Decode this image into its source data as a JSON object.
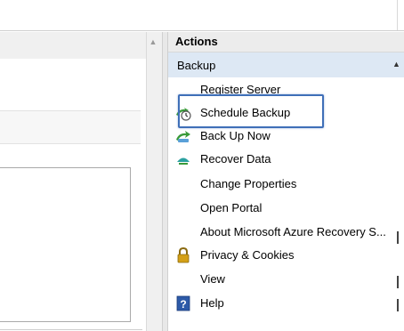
{
  "actions": {
    "title": "Actions",
    "section": "Backup",
    "items": [
      {
        "label": "Register Server",
        "icon": "none"
      },
      {
        "label": "Schedule Backup",
        "icon": "schedule-backup-icon"
      },
      {
        "label": "Back Up Now",
        "icon": "backup-now-icon"
      },
      {
        "label": "Recover Data",
        "icon": "recover-data-icon"
      },
      {
        "label": "Change Properties",
        "icon": "none"
      },
      {
        "label": "Open Portal",
        "icon": "none"
      },
      {
        "label": "About Microsoft Azure Recovery S...",
        "icon": "none"
      },
      {
        "label": "Privacy & Cookies",
        "icon": "lock-icon"
      },
      {
        "label": "View",
        "icon": "none"
      },
      {
        "label": "Help",
        "icon": "help-icon"
      }
    ]
  },
  "colors": {
    "section_bg": "#dde8f4",
    "highlight": "#3f6fb8",
    "help_blue": "#2d5aa8",
    "lock_gold": "#d4a017",
    "backup_green": "#3a9a3a"
  }
}
